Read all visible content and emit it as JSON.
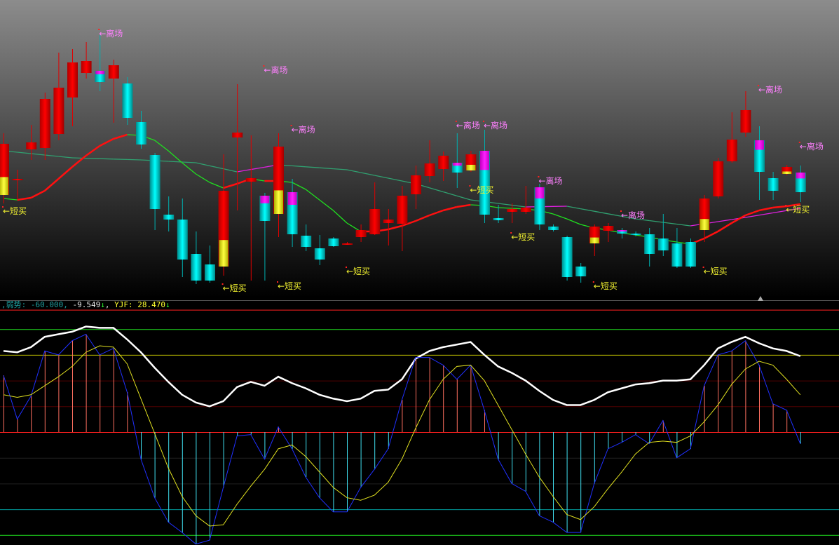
{
  "indicator_header": {
    "prefix": ",",
    "weak_label": "弱势: -60.000,",
    "value1": " -9.549",
    "arrow1": "↓",
    "sep": ",",
    "yjf_label": " YJF: 28.470",
    "arrow2": "↓"
  },
  "colors": {
    "up": "#e00000",
    "down": "#00e0e0",
    "yellow_mark": "#f0f030",
    "magenta_mark": "#ff00ff",
    "exit_text": "#ff80ff",
    "buy_text": "#f0f030"
  },
  "chart_data": [
    {
      "type": "candlestick",
      "title": "",
      "candles_ohlc": [
        [
          14.2,
          23,
          13,
          21.5
        ],
        [
          16.5,
          17.8,
          13.7,
          16.5
        ],
        [
          20.7,
          24.2,
          19.2,
          21.7
        ],
        [
          20.9,
          28.8,
          19.2,
          27.9
        ],
        [
          22.9,
          34.5,
          22,
          29.5
        ],
        [
          28.1,
          35,
          24,
          33.1
        ],
        [
          31.6,
          36,
          30.8,
          33.3
        ],
        [
          31.9,
          37,
          29,
          30.3
        ],
        [
          30.8,
          33.5,
          24.5,
          32.7
        ],
        [
          30.1,
          31,
          24.2,
          25.2
        ],
        [
          24.6,
          26.2,
          20.8,
          21.4
        ],
        [
          19.9,
          20.2,
          9.2,
          12.2
        ],
        [
          11.4,
          14,
          9,
          10.7
        ],
        [
          10.7,
          13.7,
          2.5,
          5
        ],
        [
          5.8,
          9,
          1.5,
          2
        ],
        [
          4.3,
          7,
          1.7,
          2
        ],
        [
          4,
          20,
          2.7,
          14.8
        ],
        [
          22.4,
          30,
          12,
          23.1
        ],
        [
          16.1,
          22.7,
          2,
          16.6
        ],
        [
          14.1,
          14.5,
          2,
          10.5
        ],
        [
          11.5,
          23,
          8.2,
          21.1
        ],
        [
          14.6,
          16.5,
          6.8,
          8.6
        ],
        [
          8.4,
          10,
          6.2,
          6.8
        ],
        [
          6.6,
          8.5,
          4.2,
          5
        ],
        [
          8,
          8.2,
          6.8,
          6.9
        ],
        [
          7.3,
          7.5,
          7.1,
          7.3
        ],
        [
          8.2,
          10,
          7.5,
          9.2
        ],
        [
          8.6,
          16,
          8.5,
          12.2
        ],
        [
          10.2,
          12.2,
          7,
          10.7
        ],
        [
          10.1,
          15.5,
          6.2,
          14.1
        ],
        [
          14.3,
          18.4,
          12.2,
          17
        ],
        [
          16.9,
          22,
          16,
          18.7
        ],
        [
          17.9,
          20.4,
          16.2,
          19.8
        ],
        [
          18.8,
          23,
          15.2,
          17.4
        ],
        [
          17.7,
          20.5,
          17.5,
          20
        ],
        [
          20.5,
          23.5,
          10.2,
          11.4
        ],
        [
          10.9,
          12.8,
          10.2,
          10.6
        ],
        [
          11.8,
          13,
          10.2,
          12.2
        ],
        [
          11.8,
          15.5,
          11.5,
          12.4
        ],
        [
          15.3,
          15.8,
          9.2,
          10
        ],
        [
          9.7,
          10,
          9,
          9.2
        ],
        [
          8.2,
          8.4,
          2,
          2.5
        ],
        [
          4,
          4.5,
          1.7,
          2.6
        ],
        [
          7.3,
          10,
          5.5,
          9.7
        ],
        [
          9.1,
          10.2,
          7.5,
          9.8
        ],
        [
          9.2,
          9.5,
          8,
          8.7
        ],
        [
          8.7,
          9,
          8.3,
          8.5
        ],
        [
          8.6,
          9.5,
          4,
          5.8
        ],
        [
          8,
          11.5,
          5.5,
          6.3
        ],
        [
          7.3,
          9.5,
          3.8,
          4
        ],
        [
          7.5,
          8,
          3.8,
          4
        ],
        [
          9.2,
          14.2,
          7.5,
          13.7
        ],
        [
          14,
          19.5,
          13.7,
          19
        ],
        [
          19,
          26,
          18.8,
          22.1
        ],
        [
          23.1,
          29,
          22.5,
          26.3
        ],
        [
          22,
          24,
          13.5,
          17.5
        ],
        [
          16.6,
          17.5,
          13.5,
          14.8
        ],
        [
          17.2,
          18.5,
          17,
          18.2
        ],
        [
          17.4,
          18.4,
          13.2,
          14.6
        ]
      ],
      "candle_marks": {
        "0": "y",
        "7": "m",
        "16": "y",
        "19": "m",
        "20": "y",
        "21": "m",
        "33": "m",
        "34": "y",
        "35": "m",
        "39": "m",
        "43": "y",
        "45": "m",
        "51": "y",
        "55": "m",
        "57": "y",
        "58": "m"
      },
      "ma_short": [
        13.7,
        13.5,
        13.8,
        14.8,
        16.5,
        18.2,
        19.8,
        21.2,
        22.2,
        22.8,
        22.7,
        22,
        20.5,
        18.8,
        17.2,
        16,
        15.2,
        15.8,
        16.5,
        16.2,
        16.2,
        16,
        15,
        13.5,
        12,
        10.2,
        9,
        9,
        9.3,
        9.8,
        10.5,
        11.3,
        12,
        12.5,
        12.8,
        12.7,
        12.4,
        12.3,
        12.2,
        12,
        11.5,
        10.8,
        10,
        9.5,
        9.2,
        8.8,
        8.5,
        8.2,
        7.8,
        7.5,
        7.2,
        8,
        9,
        10.2,
        11.3,
        12,
        12.4,
        12.6,
        12.9
      ],
      "ma_long_points": [
        [
          0,
          20.5
        ],
        [
          5,
          19.5
        ],
        [
          10,
          19.2
        ],
        [
          14,
          18.8
        ],
        [
          17,
          17.5
        ],
        [
          20,
          18.5
        ],
        [
          25,
          17.8
        ],
        [
          30,
          15.8
        ],
        [
          34,
          13.5
        ],
        [
          38,
          12.5
        ],
        [
          41,
          12.6
        ],
        [
          46,
          10.8
        ],
        [
          50,
          9.8
        ],
        [
          54,
          11
        ],
        [
          58,
          12.3
        ]
      ],
      "annotations_exit": {
        "label": "←离场",
        "points": [
          [
            7,
            37.3
          ],
          [
            19,
            32.1
          ],
          [
            21,
            23.6
          ],
          [
            33,
            24.2
          ],
          [
            35,
            24.2
          ],
          [
            39,
            16.3
          ],
          [
            45,
            11.4
          ],
          [
            55,
            29.3
          ],
          [
            58,
            21.2
          ]
        ]
      },
      "annotations_buy": {
        "label": "←短买",
        "points": [
          [
            0,
            12
          ],
          [
            16,
            1
          ],
          [
            20,
            1.3
          ],
          [
            25,
            3.4
          ],
          [
            34,
            15
          ],
          [
            37,
            8.3
          ],
          [
            43,
            1.3
          ],
          [
            51,
            3.4
          ],
          [
            57,
            12.2
          ]
        ]
      }
    },
    {
      "type": "line",
      "title": "YJF",
      "levels": [
        95,
        80,
        60,
        40,
        20,
        0,
        -20,
        -40,
        -60,
        -80
      ],
      "level_colors": [
        "#ff2020",
        "#20e020",
        "#c8c800",
        "#500000",
        "#500000",
        "#ff2020",
        "#202020",
        "#202020",
        "#00a0a0",
        "#20e020"
      ],
      "series": [
        {
          "name": "white",
          "color": "#ffffff",
          "values": [
            63,
            62,
            66,
            74,
            76,
            78,
            82,
            81,
            81,
            72,
            62,
            50,
            39,
            29,
            23,
            20,
            24,
            35,
            39,
            36,
            43,
            38,
            34,
            29,
            26,
            24,
            26,
            32,
            33,
            41,
            57,
            63,
            66,
            68,
            70,
            60,
            51,
            46,
            40,
            32,
            25,
            21,
            21,
            25,
            31,
            34,
            37,
            38,
            40,
            40,
            41,
            52,
            65,
            70,
            74,
            69,
            65,
            63,
            59
          ]
        },
        {
          "name": "blue",
          "color": "#2030ff",
          "values": [
            44,
            10,
            28,
            63,
            60,
            71,
            76,
            60,
            65,
            31,
            -21,
            -51,
            -70,
            -78,
            -87,
            -84,
            -43,
            -3,
            -2,
            -21,
            4,
            -13,
            -35,
            -51,
            -62,
            -62,
            -43,
            -29,
            -13,
            25,
            58,
            58,
            52,
            41,
            52,
            17,
            -21,
            -40,
            -46,
            -65,
            -70,
            -78,
            -78,
            -40,
            -13,
            -8,
            -2,
            -9,
            9,
            -20,
            -13,
            36,
            60,
            63,
            71,
            52,
            22,
            17,
            -9
          ]
        },
        {
          "name": "yellow",
          "color": "#e0e020",
          "values": [
            29,
            27,
            29,
            36,
            43,
            51,
            62,
            67,
            66,
            53,
            26,
            -1,
            -28,
            -50,
            -65,
            -73,
            -72,
            -56,
            -42,
            -29,
            -13,
            -10,
            -19,
            -31,
            -43,
            -51,
            -53,
            -49,
            -39,
            -21,
            3,
            25,
            41,
            51,
            52,
            40,
            21,
            2,
            -17,
            -35,
            -50,
            -64,
            -68,
            -58,
            -44,
            -31,
            -17,
            -8,
            -7,
            -8,
            -3,
            8,
            21,
            37,
            49,
            55,
            52,
            41,
            29
          ]
        }
      ]
    }
  ]
}
